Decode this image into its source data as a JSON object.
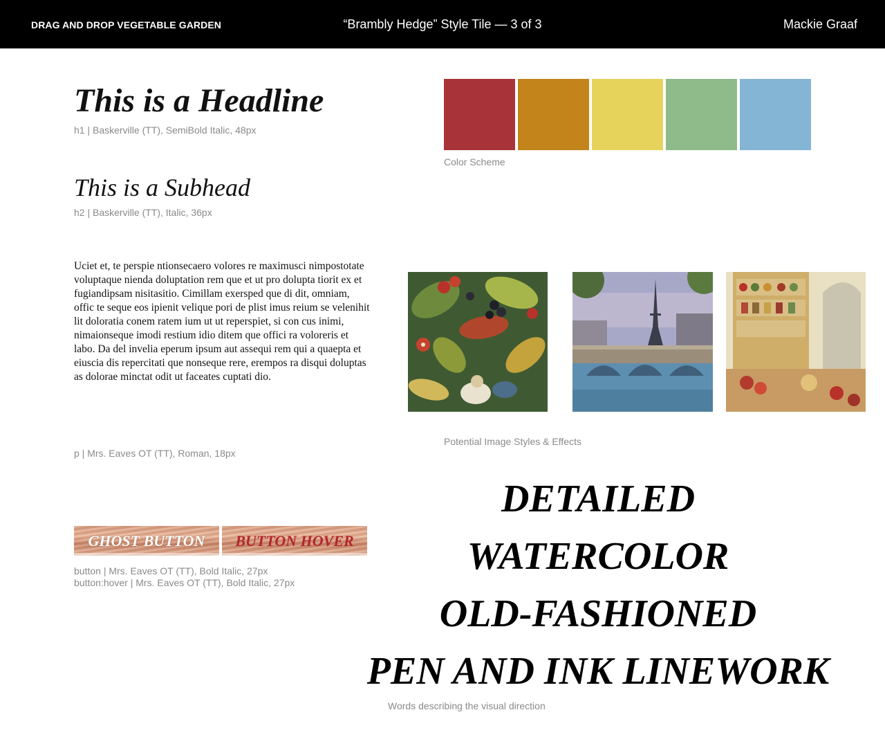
{
  "header": {
    "project": "DRAG AND DROP VEGETABLE GARDEN",
    "title": "“Brambly Hedge” Style Tile — 3 of 3",
    "author": "Mackie Graaf"
  },
  "typography": {
    "h1": {
      "text": "This is a Headline",
      "caption": "h1 | Baskerville (TT), SemiBold Italic, 48px"
    },
    "h2": {
      "text": "This is a Subhead",
      "caption": "h2 | Baskerville (TT), Italic, 36px"
    },
    "paragraph": {
      "text": "Uciet et, te perspie ntionsecaero volores re maximusci nimpostotate voluptaque nienda doluptation rem que et ut pro dolupta tiorit ex et fugiandipsam nisitasitio. Cimillam exersped que di dit, omniam, offic te seque eos ipienit velique pori de plist imus reium se velenihit lit doloratia conem ratem ium ut ut reperspiet, si con cus inimi, nimaionseque imodi restium idio ditem que offici ra voloreris et labo. Da del invelia eperum ipsum aut assequi rem qui a quaepta et eiuscia dis repercitati que nonseque rere, erempos ra disqui doluptas as dolorae minctat odit ut faceates cuptati dio.",
      "caption": "p | Mrs. Eaves OT (TT), Roman, 18px"
    }
  },
  "buttons": {
    "ghost_label": "GHOST BUTTON",
    "hover_label": "BUTTON HOVER",
    "caption_button": "button | Mrs. Eaves OT (TT), Bold Italic, 27px",
    "caption_hover": "button:hover | Mrs. Eaves OT (TT), Bold Italic, 27px"
  },
  "color_scheme": {
    "caption": "Color Scheme",
    "colors": [
      "#a8343a",
      "#c2841b",
      "#e6d35c",
      "#8ebb89",
      "#84b5d4"
    ]
  },
  "images": {
    "caption": "Potential Image Styles & Effects",
    "items": [
      "bramble-illustration",
      "paris-bridge-illustration",
      "pantry-illustration"
    ]
  },
  "visual_direction": {
    "words": [
      "DETAILED",
      "WATERCOLOR",
      "OLD-FASHIONED",
      "PEN AND INK LINEWORK"
    ],
    "caption": "Words describing the visual direction"
  }
}
